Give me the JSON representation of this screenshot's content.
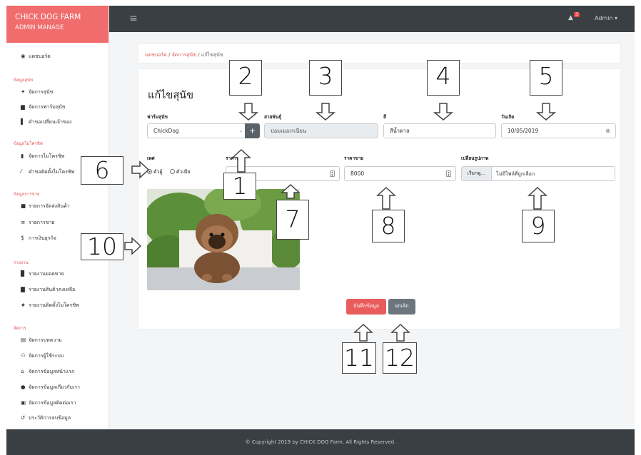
{
  "brand": {
    "title": "CHICK DOG FARM",
    "subtitle": "ADMIN MANAGE"
  },
  "topbar": {
    "menu_icon": "hamburger-icon",
    "notification_count": "3",
    "user": "Admin ▾"
  },
  "sidebar": {
    "dashboard": "แดชบอร์ด",
    "sections": [
      {
        "title": "ข้อมูลสุนัข",
        "items": [
          "จัดการสุนัข",
          "จัดการฟาร์มสุนัข",
          "ตำขอเปลี่ยนเจ้าของ"
        ]
      },
      {
        "title": "ข้อมูลไมโครชิพ",
        "items": [
          "จัดการไมโครชิพ",
          "คำขอติดตั้งไมโครชิพ"
        ]
      },
      {
        "title": "ข้อมูลการขาย",
        "items": [
          "รายการจัดส่งสินค้า",
          "รายการขาย",
          "การเงินธุรกิจ"
        ]
      },
      {
        "title": "รายงาน",
        "items": [
          "รายงานยอดขาย",
          "รายงานสินค้าคงเหลือ",
          "รายงานติดตั้งไมโครชิพ"
        ]
      },
      {
        "title": "จัดการ",
        "items": [
          "จัดการบทความ",
          "จัดการผู้ใช้ระบบ",
          "จัดการข้อมูลหน้าแรก",
          "จัดการข้อมูลเกี่ยวกับเรา",
          "จัดการข้อมูลติดต่อเรา",
          "ประวัติการลบข้อมูล"
        ]
      }
    ]
  },
  "breadcrumb": {
    "home": "แดชบอร์ด",
    "sep": " / ",
    "parent": "จัดการสุนัข",
    "current": "แก้ไขสุนัข"
  },
  "form": {
    "title": "แก้ไขสุนัข",
    "farm": {
      "label": "ฟาร์มสุนัข",
      "value": "ChickDog",
      "add": "+"
    },
    "breed": {
      "label": "สายพันธุ์",
      "value": "ปอมเมอเรเนียน"
    },
    "color": {
      "label": "สี",
      "value": "สีน้ำตาล"
    },
    "birthday": {
      "label": "วันเกิด",
      "value": "10/05/2019"
    },
    "gender": {
      "label": "เพศ",
      "male": "ตัวผู้",
      "female": "ตัวเมีย",
      "selected": "male"
    },
    "cost": {
      "label": "ราคาทุน"
    },
    "price": {
      "label": "ราคาขาย",
      "value": "8000"
    },
    "image": {
      "label": "เปลี่ยนรูปภาพ",
      "browse": "เรียกดู...",
      "status": "ไม่มีไฟล์ที่ถูกเลือก"
    },
    "save": "บันทึกข้อมูล",
    "cancel": "ยกเลิก"
  },
  "footer": "© Copyright 2019 by CHICK DOG Farm. All Rights Reserved.",
  "annotations": [
    "1",
    "2",
    "3",
    "4",
    "5",
    "6",
    "7",
    "8",
    "9",
    "10",
    "11",
    "12"
  ],
  "colors": {
    "brand": "#f16d6d",
    "topbar": "#3a3f44",
    "save": "#e85c5c",
    "cancel": "#6c757d"
  }
}
